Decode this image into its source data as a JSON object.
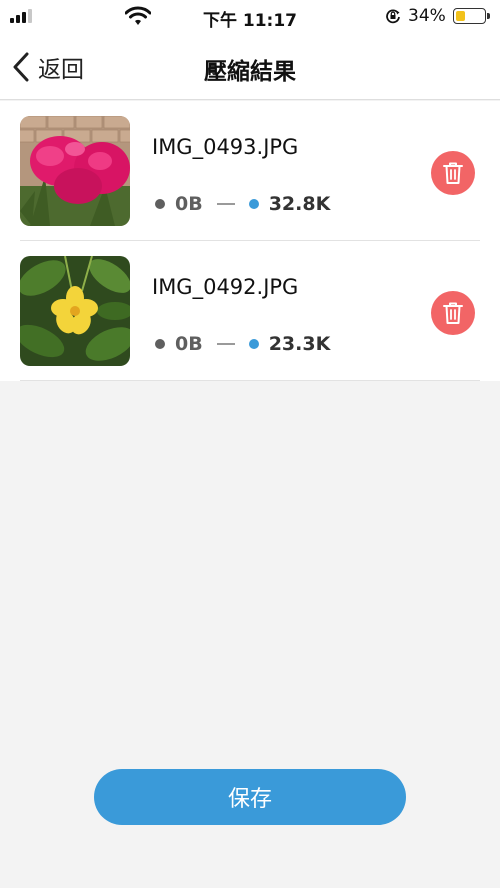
{
  "status_bar": {
    "time": "下午 11:17",
    "battery_percent": "34%",
    "battery_level": 0.34,
    "signal_bars_filled": 3,
    "icons": [
      "signal-icon",
      "wifi-icon",
      "orientation-lock-icon",
      "battery-icon"
    ]
  },
  "nav": {
    "back_label": "返回",
    "title": "壓縮結果",
    "back_icon": "chevron-left-icon"
  },
  "files": [
    {
      "name": "IMG_0493.JPG",
      "original_size": "0B",
      "compressed_size": "32.8K",
      "thumbnail": "pink-celosia-flower"
    },
    {
      "name": "IMG_0492.JPG",
      "original_size": "0B",
      "compressed_size": "23.3K",
      "thumbnail": "yellow-flower"
    }
  ],
  "actions": {
    "save_label": "保存",
    "delete_icon": "trash-icon"
  },
  "colors": {
    "accent": "#3a9ad9",
    "delete": "#f26566",
    "original_dot": "#5f5f5f",
    "background": "#f3f3f3",
    "battery_fill": "#f2c21b"
  }
}
